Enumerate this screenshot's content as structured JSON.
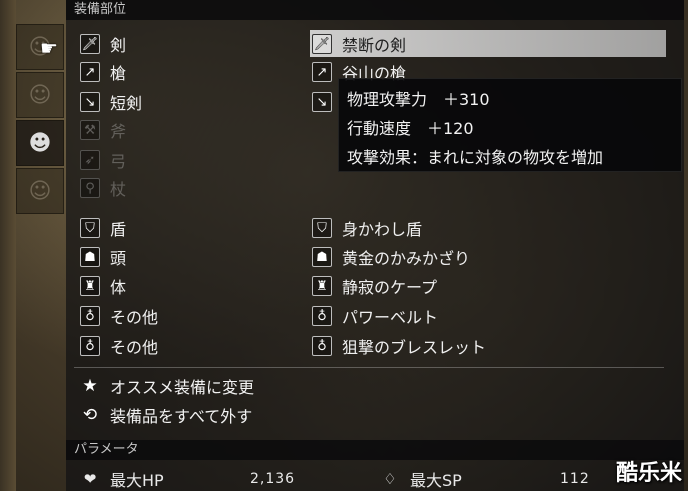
{
  "header": {
    "title": "装備部位"
  },
  "slots": [
    {
      "icon": "sword-icon",
      "glyph": "🗡",
      "label": "剣",
      "equipped": "禁断の剣",
      "eq_icon": "sword-icon",
      "eq_glyph": "🗡",
      "dim": false
    },
    {
      "icon": "spear-icon",
      "glyph": "↗",
      "label": "槍",
      "equipped": "谷山の槍",
      "eq_icon": "spear-icon",
      "eq_glyph": "↗",
      "dim": false
    },
    {
      "icon": "dagger-icon",
      "glyph": "↘",
      "label": "短剣",
      "equipped": "",
      "eq_icon": "dagger-icon",
      "eq_glyph": "↘",
      "dim": false
    },
    {
      "icon": "axe-icon",
      "glyph": "⚒",
      "label": "斧",
      "equipped": "",
      "dim": true
    },
    {
      "icon": "bow-icon",
      "glyph": "➶",
      "label": "弓",
      "equipped": "",
      "dim": true
    },
    {
      "icon": "staff-icon",
      "glyph": "⚲",
      "label": "杖",
      "equipped": "",
      "dim": true
    },
    {
      "icon": "shield-icon",
      "glyph": "⛉",
      "label": "盾",
      "equipped": "身かわし盾",
      "eq_icon": "shield-icon",
      "eq_glyph": "⛉",
      "dim": false
    },
    {
      "icon": "helmet-icon",
      "glyph": "☗",
      "label": "頭",
      "equipped": "黄金のかみかざり",
      "eq_icon": "helmet-icon",
      "eq_glyph": "☗",
      "dim": false
    },
    {
      "icon": "armor-icon",
      "glyph": "♜",
      "label": "体",
      "equipped": "静寂のケープ",
      "eq_icon": "armor-icon",
      "eq_glyph": "♜",
      "dim": false
    },
    {
      "icon": "accessory-icon",
      "glyph": "♁",
      "label": "その他",
      "equipped": "パワーベルト",
      "eq_icon": "accessory-icon",
      "eq_glyph": "♁",
      "dim": false
    },
    {
      "icon": "accessory-icon",
      "glyph": "♁",
      "label": "その他",
      "equipped": "狙撃のブレスレット",
      "eq_icon": "accessory-icon",
      "eq_glyph": "♁",
      "dim": false
    }
  ],
  "tooltip": {
    "line1": "物理攻撃力　＋310",
    "line2": "行動速度　＋120",
    "line3": "攻撃効果：まれに対象の物攻を増加"
  },
  "commands": [
    {
      "icon": "star-icon",
      "glyph": "★",
      "label": "オススメ装備に変更"
    },
    {
      "icon": "unequip-icon",
      "glyph": "⟲",
      "label": "装備品をすべて外す"
    }
  ],
  "params": {
    "title": "パラメータ",
    "hp_label": "最大HP",
    "hp_value": "2,136",
    "sp_label": "最大SP",
    "sp_value": "112"
  },
  "watermark": "酷乐米"
}
